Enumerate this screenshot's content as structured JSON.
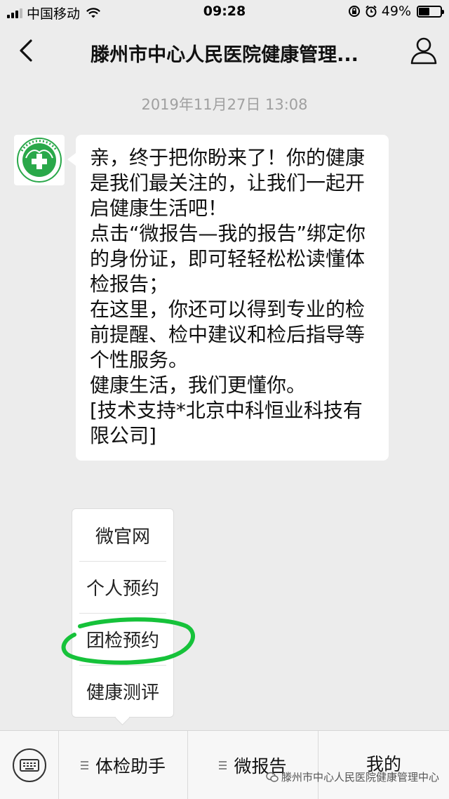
{
  "status_bar": {
    "carrier": "中国移动",
    "time": "09:28",
    "battery_percent": "49%",
    "battery_level": 0.49
  },
  "nav": {
    "title": "滕州市中心人民医院健康管理..."
  },
  "chat": {
    "timestamp": "2019年11月27日 13:08",
    "message": "亲，终于把你盼来了！你的健康是我们最关注的，让我们一起开启健康生活吧！\n点击“微报告—我的报告”绑定你的身份证，即可轻轻松松读懂体检报告；\n在这里，你还可以得到专业的检前提醒、检中建议和检后指导等个性服务。\n健康生活，我们更懂你。\n[技术支持*北京中科恒业科技有限公司]"
  },
  "popup_menu": {
    "items": [
      "微官网",
      "个人预约",
      "团检预约",
      "健康测评"
    ]
  },
  "bottom_menu": {
    "tabs": [
      "体检助手",
      "微报告",
      "我的"
    ]
  },
  "watermark": "滕州市中心人民医院健康管理中心",
  "colors": {
    "background": "#ececec",
    "highlight_circle": "#16c23a",
    "logo_green": "#2aa84a"
  }
}
